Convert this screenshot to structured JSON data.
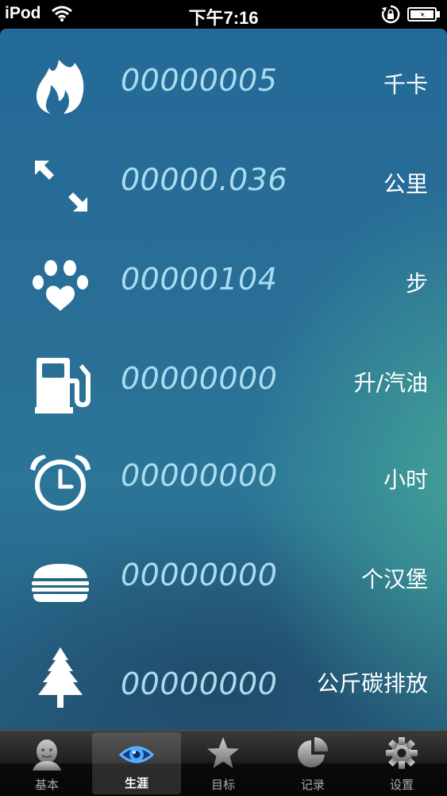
{
  "status_bar": {
    "carrier": "iPod",
    "time": "下午7:16"
  },
  "stats": [
    {
      "icon": "flame-icon",
      "value": "00000005",
      "unit": "千卡"
    },
    {
      "icon": "distance-arrows-icon",
      "value": "00000.036",
      "unit": "公里"
    },
    {
      "icon": "paw-icon",
      "value": "00000104",
      "unit": "步"
    },
    {
      "icon": "gas-pump-icon",
      "value": "00000000",
      "unit": "升/汽油"
    },
    {
      "icon": "alarm-clock-icon",
      "value": "00000000",
      "unit": "小时"
    },
    {
      "icon": "hamburger-icon",
      "value": "00000000",
      "unit": "个汉堡"
    },
    {
      "icon": "tree-icon",
      "value": "00000000",
      "unit": "公斤碳排放"
    }
  ],
  "tabs": [
    {
      "icon": "profile-face-icon",
      "label": "基本",
      "selected": false
    },
    {
      "icon": "eye-icon",
      "label": "生涯",
      "selected": true
    },
    {
      "icon": "star-icon",
      "label": "目标",
      "selected": false
    },
    {
      "icon": "pie-chart-icon",
      "label": "记录",
      "selected": false
    },
    {
      "icon": "gear-icon",
      "label": "设置",
      "selected": false
    }
  ],
  "colors": {
    "value_text": "#a9dcee",
    "unit_text": "#ffffff",
    "background_top": "#246a98",
    "background_glow": "#46aa96",
    "tab_bar": "#1e1e1e"
  }
}
